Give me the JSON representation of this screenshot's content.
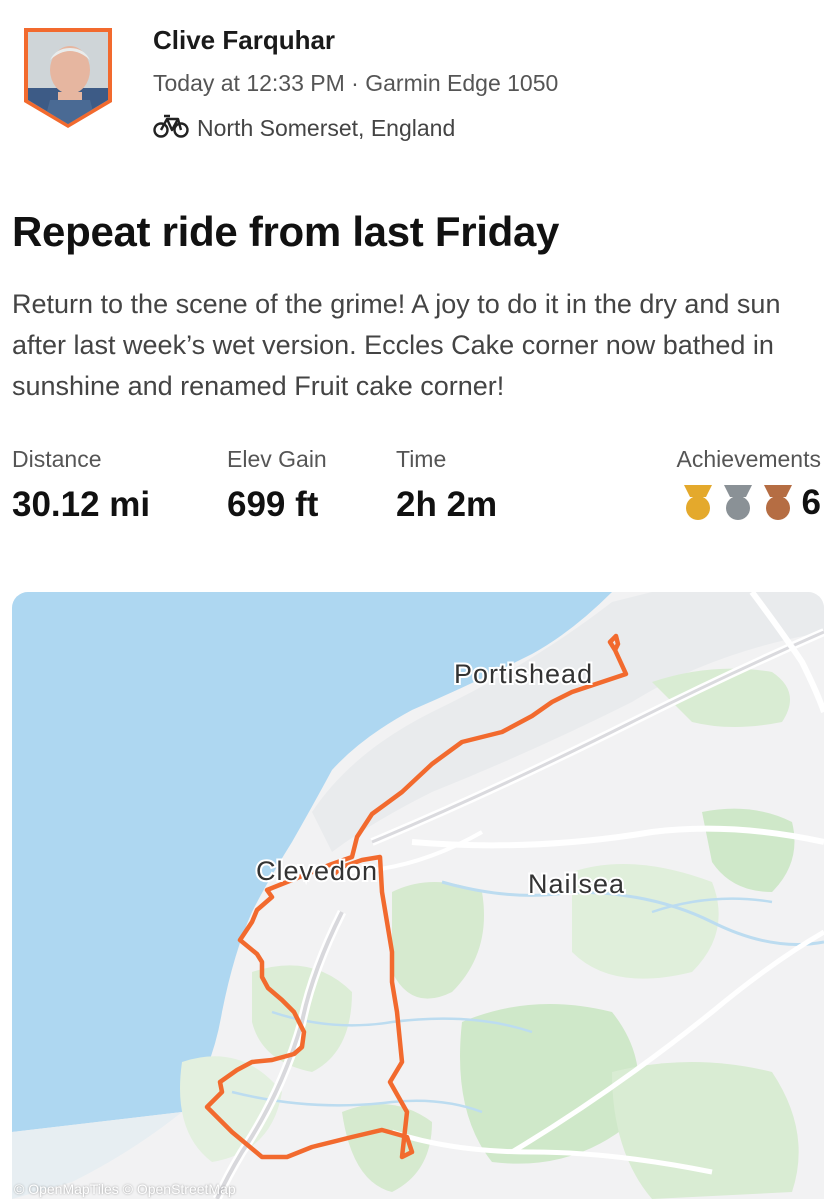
{
  "athlete": {
    "name": "Clive Farquhar"
  },
  "activity": {
    "meta": "Today at 12:33 PM · Garmin Edge 1050",
    "location": "North Somerset, England",
    "sport_icon": "bike-icon",
    "title": "Repeat ride from last Friday",
    "description": "Return to the scene of the grime! A joy to do it in the dry and sun after last week’s wet version. Eccles Cake corner now bathed in sunshine and renamed Fruit cake corner!"
  },
  "stats": {
    "distance": {
      "label": "Distance",
      "value": "30.12 mi"
    },
    "elev_gain": {
      "label": "Elev Gain",
      "value": "699 ft"
    },
    "time": {
      "label": "Time",
      "value": "2h 2m"
    },
    "achievements": {
      "label": "Achievements",
      "count": "6",
      "medals": [
        "gold",
        "silver",
        "bronze"
      ],
      "colors": {
        "gold": "#e4a92c",
        "silver": "#8a9196",
        "bronze": "#b56d43"
      }
    }
  },
  "map": {
    "places": {
      "portishead": "Portishead",
      "clevedon": "Clevedon",
      "nailsea": "Nailsea"
    },
    "attribution": "© OpenMapTiles © OpenStreetMap",
    "colors": {
      "water": "#aed7f1",
      "land": "#f2f2f3",
      "green": "#cfe8c9",
      "route": "#f26a2e"
    }
  }
}
